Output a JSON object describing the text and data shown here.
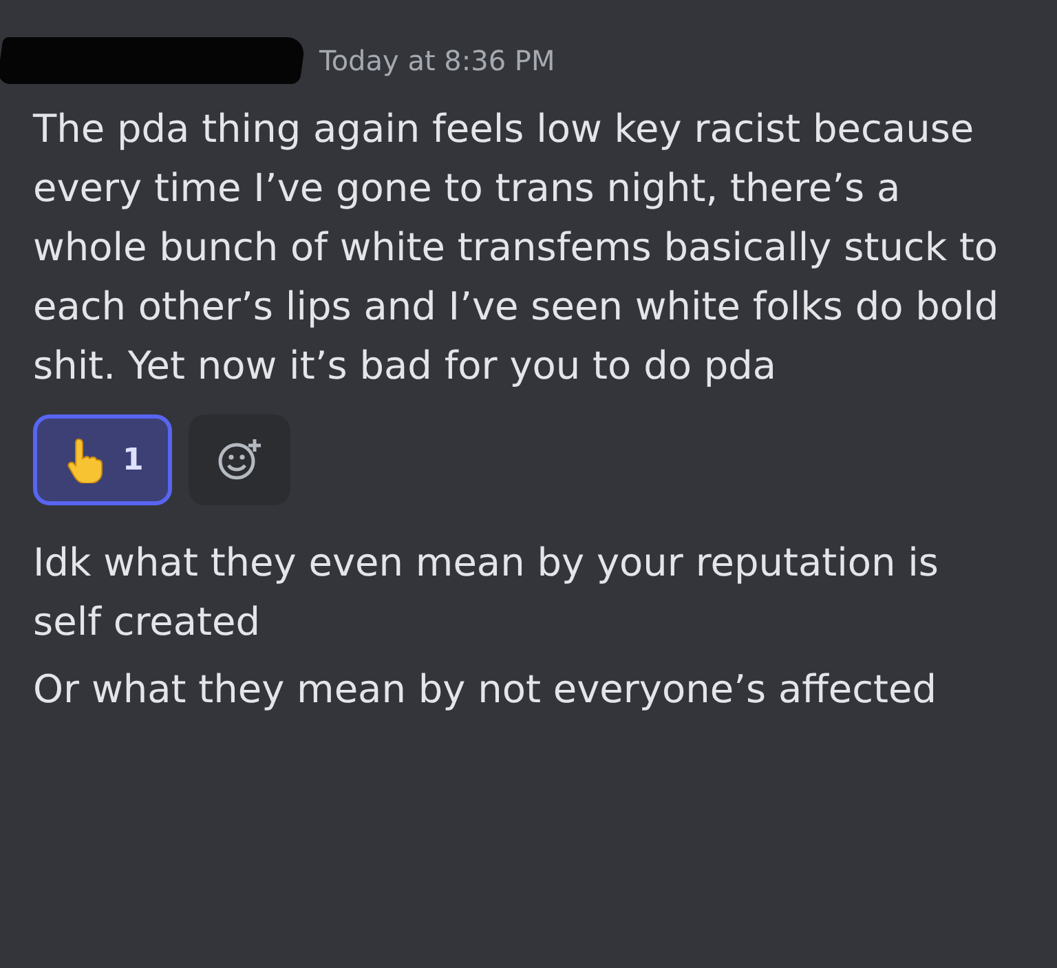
{
  "header": {
    "timestamp": "Today at 8:36 PM"
  },
  "messages": [
    {
      "text": "The pda thing again feels low key racist because every time I’ve gone to trans night, there’s a whole bunch of white transfems basically stuck to each other’s lips and I’ve seen white folks do bold shit. Yet now it’s bad for you to do pda",
      "reactions": [
        {
          "count": "1",
          "selected": true
        }
      ]
    },
    {
      "text": "Idk what they even mean by your reputation is self created"
    },
    {
      "text": "Or what they mean by not everyone’s affected"
    }
  ]
}
